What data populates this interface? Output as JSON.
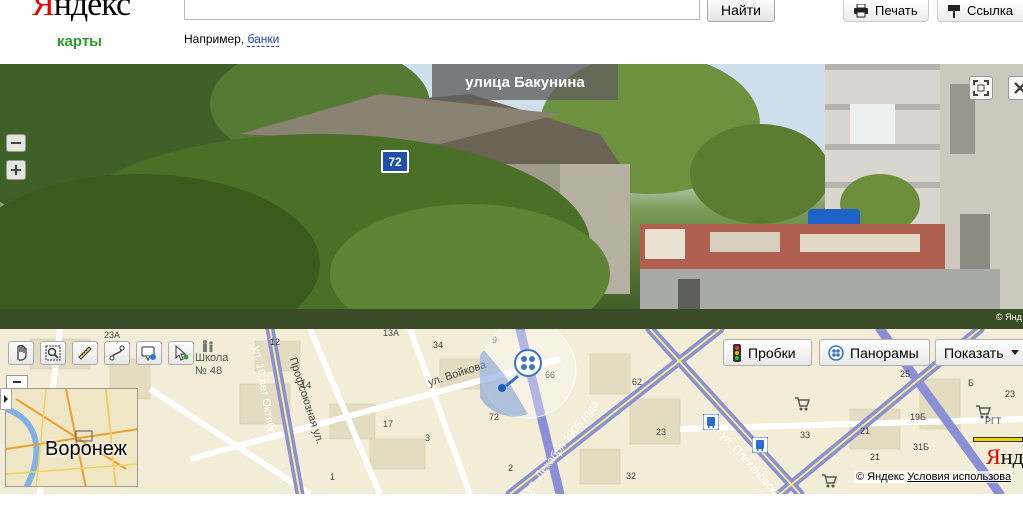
{
  "header": {
    "logo_first": "Я",
    "logo_rest": "ндекс",
    "logo_sub": "карты",
    "search": {
      "value": "",
      "placeholder": ""
    },
    "find_label": "Найти",
    "example_prefix": "Например, ",
    "example_link": "банки",
    "print_label": "Печать",
    "link_label": "Ссылка"
  },
  "panorama": {
    "street_title": "улица Бакунина",
    "house_number": "72",
    "copyright": "© Янд"
  },
  "map": {
    "traffic_label": "Пробки",
    "panoramas_label": "Панорамы",
    "show_label": "Показать",
    "school_label_1": "Школа",
    "school_label_2": "№ 48",
    "mini_map_label": "Воронеж",
    "streets": {
      "voykova": "ул. Войкова",
      "profsoyuznaya": "Профсоюзная ул.",
      "octyabrya": "ул. 10 лет Октября",
      "dec1905": "ул. Декабря 1905 года",
      "plekhanovskaya": "ул. Плехановская"
    },
    "house_numbers": [
      "23А",
      "12",
      "13А",
      "14",
      "34",
      "9",
      "66",
      "62",
      "72",
      "17",
      "3",
      "2",
      "1",
      "23",
      "32",
      "25",
      "31Б",
      "23",
      "21",
      "19Б",
      "33",
      "21",
      "РГТ",
      "Б"
    ],
    "copyright_prefix": "© Яндекс",
    "terms_link": "Условия использова",
    "scale_logo_first": "Я",
    "scale_logo_rest": "нде"
  },
  "colors": {
    "brand_red": "#ee0000",
    "brand_green": "#2b9a2b",
    "link_blue": "#1a3dc1",
    "major_road": "#8b8fd6",
    "map_bg": "#f3ecd6"
  },
  "icons": [
    "printer-icon",
    "link-icon",
    "hand-icon",
    "zoom-rect-icon",
    "ruler-icon",
    "route-icon",
    "placemark-icon",
    "pano-person-icon",
    "traffic-light-icon",
    "panorama-icon",
    "chevron-down-icon",
    "fullscreen-icon",
    "close-icon",
    "shopping-cart-icon",
    "metro-icon"
  ]
}
